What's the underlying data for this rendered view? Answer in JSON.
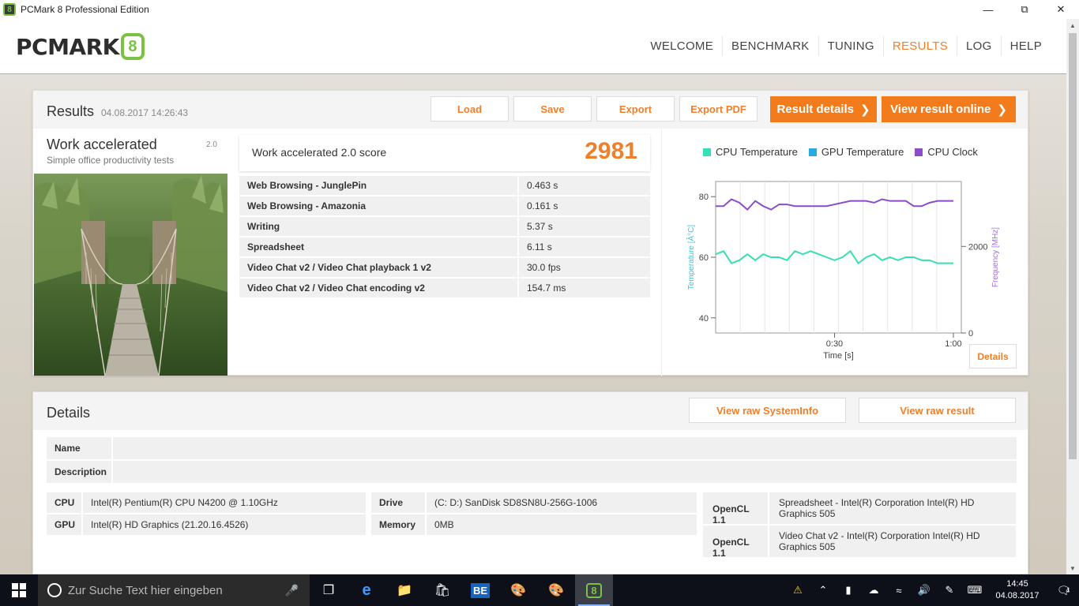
{
  "window": {
    "title": "PCMark 8 Professional Edition"
  },
  "header": {
    "logo_text": "PCMARK",
    "logo_mark": "8",
    "nav": [
      "WELCOME",
      "BENCHMARK",
      "TUNING",
      "RESULTS",
      "LOG",
      "HELP"
    ],
    "active_nav": "RESULTS"
  },
  "results": {
    "title": "Results",
    "date": "04.08.2017 14:26:43",
    "buttons": {
      "load": "Load",
      "save": "Save",
      "export": "Export",
      "export_pdf": "Export PDF",
      "result_details": "Result details",
      "view_online": "View result online"
    },
    "test": {
      "name": "Work accelerated",
      "version": "2.0",
      "subtitle": "Simple office productivity tests"
    },
    "score": {
      "label": "Work accelerated 2.0 score",
      "value": "2981"
    },
    "subscores": [
      {
        "name": "Web Browsing - JunglePin",
        "value": "0.463 s"
      },
      {
        "name": "Web Browsing - Amazonia",
        "value": "0.161 s"
      },
      {
        "name": "Writing",
        "value": "5.37 s"
      },
      {
        "name": "Spreadsheet",
        "value": "6.11 s"
      },
      {
        "name": "Video Chat v2 / Video Chat playback 1 v2",
        "value": "30.0 fps"
      },
      {
        "name": "Video Chat v2 / Video Chat encoding v2",
        "value": "154.7 ms"
      }
    ],
    "chart_details_label": "Details"
  },
  "chart_data": {
    "type": "line",
    "legend": [
      "CPU Temperature",
      "GPU Temperature",
      "CPU Clock"
    ],
    "colors": {
      "cpu_temp": "#36e0b4",
      "gpu_temp": "#2aa8e0",
      "cpu_clock": "#8a4cc8"
    },
    "xlabel": "Time [s]",
    "ylabel_left": "Temperature [Â°C]",
    "ylabel_right": "Frequency [MHz]",
    "x_ticks": [
      "0:30",
      "1:00"
    ],
    "y_left_ticks": [
      "40",
      "60",
      "80"
    ],
    "y_right_ticks": [
      "0",
      "2000"
    ],
    "x_range_s": [
      0,
      62
    ],
    "y_left_range": [
      35,
      85
    ],
    "y_right_range": [
      0,
      3500
    ],
    "x": [
      0,
      2,
      4,
      6,
      8,
      10,
      12,
      14,
      16,
      18,
      20,
      22,
      24,
      26,
      28,
      30,
      32,
      34,
      36,
      38,
      40,
      42,
      44,
      46,
      48,
      50,
      52,
      54,
      56,
      58,
      60
    ],
    "series": [
      {
        "name": "CPU Temperature",
        "values": [
          61,
          62,
          58,
          59,
          61,
          59,
          61,
          60,
          60,
          59,
          62,
          61,
          62,
          61,
          60,
          59,
          60,
          62,
          58,
          60,
          61,
          59,
          60,
          59,
          60,
          60,
          59,
          59,
          58,
          58,
          58
        ]
      },
      {
        "name": "CPU Clock",
        "values": [
          2930,
          2930,
          3090,
          3010,
          2850,
          3050,
          2930,
          2850,
          2970,
          2970,
          2930,
          2930,
          2930,
          2930,
          2930,
          2970,
          3010,
          3050,
          3050,
          3050,
          3010,
          3090,
          3050,
          3050,
          3050,
          2930,
          2930,
          3010,
          3050,
          3050,
          3050
        ]
      }
    ]
  },
  "details": {
    "title": "Details",
    "view_sysinfo": "View raw SystemInfo",
    "view_result": "View raw result",
    "name_label": "Name",
    "description_label": "Description",
    "cpu_label": "CPU",
    "cpu": "Intel(R) Pentium(R) CPU N4200 @ 1.10GHz",
    "gpu_label": "GPU",
    "gpu": "Intel(R) HD Graphics (21.20.16.4526)",
    "drive_label": "Drive",
    "drive": "(C: D:) SanDisk SD8SN8U-256G-1006",
    "memory_label": "Memory",
    "memory": "0MB",
    "opencl": [
      {
        "label": "OpenCL 1.1",
        "line1": "Spreadsheet - Intel(R) Corporation Intel(R) HD",
        "line2": "Graphics 505"
      },
      {
        "label": "OpenCL 1.1",
        "line1": "Video Chat v2 - Intel(R) Corporation Intel(R) HD",
        "line2": "Graphics 505"
      }
    ]
  },
  "taskbar": {
    "search_placeholder": "Zur Suche Text hier eingeben",
    "time": "14:45",
    "date": "04.08.2017",
    "notification_count": "4"
  }
}
